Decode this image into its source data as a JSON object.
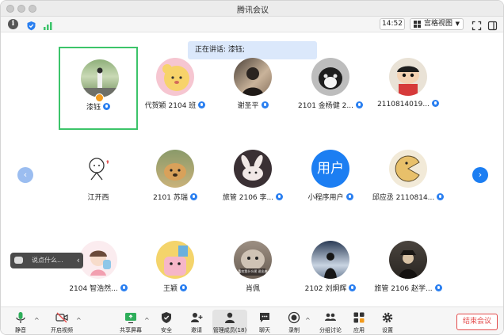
{
  "window": {
    "title": "腾讯会议"
  },
  "toolbar": {
    "time": "14:52",
    "view_label": "宫格视图",
    "icons": [
      "info-icon",
      "shield-icon",
      "signal-icon",
      "fullscreen-icon",
      "sidebar-icon"
    ]
  },
  "speaking": {
    "text": "正在讲话: 漆钰;"
  },
  "participants": [
    {
      "name": "漆钰",
      "avatar": "photo-person-outdoors",
      "active_speaker": true
    },
    {
      "name": "代贺颖 2104 班",
      "avatar": "cartoon-bear"
    },
    {
      "name": "谢圣平",
      "avatar": "photo-portrait-dark"
    },
    {
      "name": "2101 金杨健 2...",
      "avatar": "photo-cat-black-white"
    },
    {
      "name": "2110814019...",
      "avatar": "cartoon-crayon-shin"
    },
    {
      "name": "江开西",
      "avatar": "sketch-character"
    },
    {
      "name": "2101 苏瑞",
      "avatar": "photo-dog"
    },
    {
      "name": "旅管 2106 李...",
      "avatar": "photo-rabbit"
    },
    {
      "name": "小程序用户",
      "avatar": "text-avatar",
      "avatar_text": "用户"
    },
    {
      "name": "邱应丞 2110814...",
      "avatar": "pacman-character"
    },
    {
      "name": "2104 智浩然...",
      "avatar": "cartoon-girl"
    },
    {
      "name": "王颖",
      "avatar": "cartoon-pink-character"
    },
    {
      "name": "肖佩",
      "avatar": "photo-cat-meme",
      "avatar_caption": "喜欢我什么呢 说出来"
    },
    {
      "name": "2102 刘炯辉",
      "avatar": "photo-sunset-person"
    },
    {
      "name": "旅管 2106 赵学...",
      "avatar": "photo-person-hat"
    }
  ],
  "chat": {
    "placeholder": "说点什么..."
  },
  "bottom_bar": {
    "mute": "静音",
    "video": "开启视频",
    "share": "共享屏幕",
    "security": "安全",
    "invite": "邀请",
    "manage": "管理成员(18)",
    "chat": "聊天",
    "record": "录制",
    "breakout": "分组讨论",
    "apps": "应用",
    "settings": "设置",
    "end": "结束会议"
  },
  "colors": {
    "accent": "#2a7ff0",
    "active_border": "#3cc46a",
    "end": "#e34b4b",
    "banner": "#dbe8fb"
  }
}
